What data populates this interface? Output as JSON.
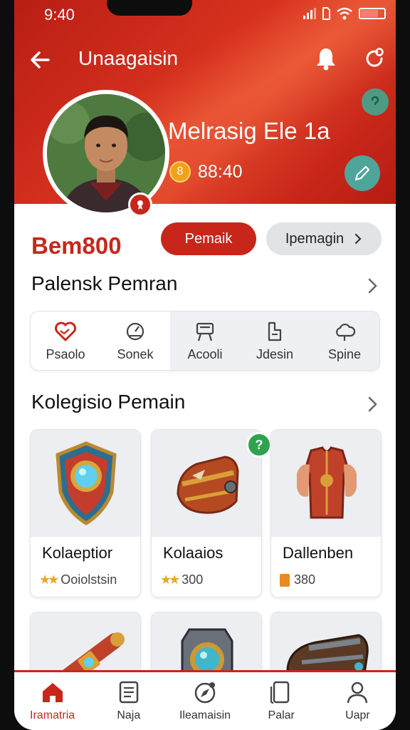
{
  "status_bar": {
    "time": "9:40"
  },
  "header": {
    "title": "Unaagaisin",
    "display_name": "Melrasig Ele 1a",
    "score": "88:40",
    "coin_symbol": "8"
  },
  "profile": {
    "username": "Bem800",
    "primary_button": "Pemaik",
    "secondary_button": "Ipemagin"
  },
  "stats_section": {
    "title": "Palensk Pemran",
    "items": [
      {
        "label": "Psaolo",
        "icon": "heart-icon"
      },
      {
        "label": "Sonek",
        "icon": "gauge-icon"
      },
      {
        "label": "Acooli",
        "icon": "easel-icon"
      },
      {
        "label": "Jdesin",
        "icon": "document-icon"
      },
      {
        "label": "Spine",
        "icon": "cloud-icon"
      }
    ]
  },
  "collection_section": {
    "title": "Kolegisio Pemain",
    "cards": [
      {
        "name": "Kolaeptior",
        "meta": "Ooiolstsin",
        "meta_icon": "stars-icon",
        "art": "shield-art"
      },
      {
        "name": "Kolaaios",
        "meta": "300",
        "meta_icon": "stars-icon",
        "art": "bracer-art"
      },
      {
        "name": "Dallenben",
        "meta": "380",
        "meta_icon": "ticket-icon",
        "art": "armor-art"
      }
    ],
    "new_badge_symbol": "?"
  },
  "bottom_nav": [
    {
      "label": "Iramatria",
      "icon": "home-icon",
      "active": true
    },
    {
      "label": "Naja",
      "icon": "list-icon",
      "active": false
    },
    {
      "label": "Ileamaisin",
      "icon": "compass-icon",
      "active": false
    },
    {
      "label": "Palar",
      "icon": "device-icon",
      "active": false
    },
    {
      "label": "Uapr",
      "icon": "user-icon",
      "active": false
    }
  ],
  "colors": {
    "brand_red": "#c8261b",
    "teal": "#4ea59a",
    "gold": "#e7a823",
    "green_badge": "#2fa24d"
  }
}
